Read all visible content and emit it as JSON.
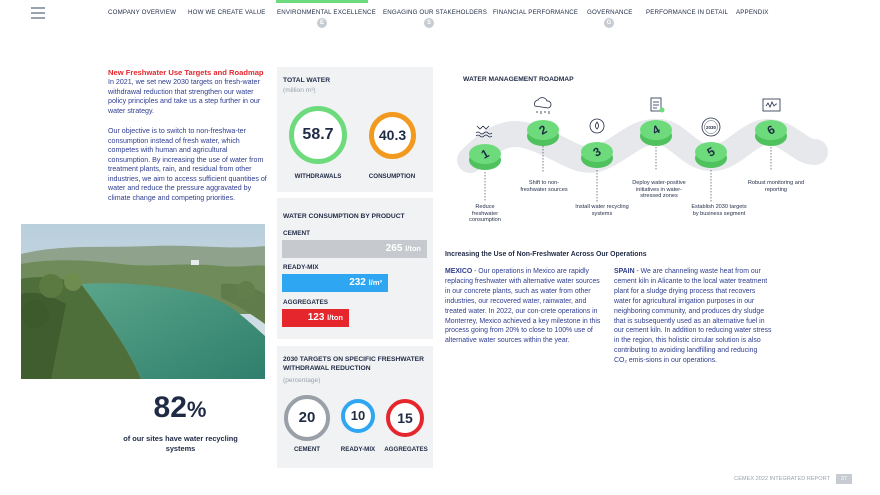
{
  "nav": {
    "items": [
      "COMPANY OVERVIEW",
      "HOW WE CREATE VALUE",
      "ENVIRONMENTAL EXCELLENCE",
      "ENGAGING OUR STAKEHOLDERS",
      "FINANCIAL PERFORMANCE",
      "GOVERNANCE",
      "PERFORMANCE IN DETAIL",
      "APPENDIX"
    ],
    "badges": [
      "E",
      "S",
      "G"
    ],
    "active_color": "#6ddb7b"
  },
  "intro": {
    "title": "New Freshwater Use Targets and Roadmap",
    "para1": "In 2021, we set new 2030 targets on fresh-water withdrawal reduction that strengthen our water policy principles and take us a step further in our water strategy.",
    "para2": "Our objective is to switch to non-freshwa-ter consumption instead of fresh water, which competes with human and agricultural consumption. By increasing the use of water from treatment plants, rain, and residual from other industries, we aim to access sufficient quantities of water and reduce the pressure aggravated by climate change and competing priorities."
  },
  "stat": {
    "value": "82",
    "unit": "%",
    "caption": "of our sites have water recycling systems"
  },
  "total_water": {
    "title": "TOTAL WATER",
    "subtitle": "(million m³)",
    "withdrawals_value": "58.7",
    "withdrawals_label": "WITHDRAWALS",
    "consumption_value": "40.3",
    "consumption_label": "CONSUMPTION",
    "colors": {
      "withdrawals": "#6ddb7b",
      "consumption": "#f29a1f"
    }
  },
  "by_product": {
    "title": "WATER CONSUMPTION BY PRODUCT",
    "items": [
      {
        "label": "CEMENT",
        "value": "265",
        "unit": "l/ton",
        "color": "#c6c9ce"
      },
      {
        "label": "READY-MIX",
        "value": "232",
        "unit": "l/m³",
        "color": "#2ea6f1"
      },
      {
        "label": "AGGREGATES",
        "value": "123",
        "unit": "l/ton",
        "color": "#e5262d"
      }
    ]
  },
  "targets": {
    "title": "2030 TARGETS ON SPECIFIC FRESHWATER WITHDRAWAL REDUCTION",
    "subtitle": "(percentage)",
    "items": [
      {
        "value": "20",
        "label": "CEMENT",
        "color": "#9aa0a8"
      },
      {
        "value": "10",
        "label": "READY-MIX",
        "color": "#2ea6f1"
      },
      {
        "value": "15",
        "label": "AGGREGATES",
        "color": "#e5262d"
      }
    ]
  },
  "roadmap": {
    "title": "WATER MANAGEMENT ROADMAP",
    "steps": [
      {
        "num": "1",
        "label": "Reduce freshwater consumption",
        "icon": "water-waves-icon"
      },
      {
        "num": "2",
        "label": "Shift to non-freshwater sources",
        "icon": "rain-cloud-icon"
      },
      {
        "num": "3",
        "label": "Install water recycling systems",
        "icon": "recycle-drop-icon"
      },
      {
        "num": "4",
        "label": "Deploy water-positive initiatives in water-stressed zones",
        "icon": "checklist-icon"
      },
      {
        "num": "5",
        "label": "Establish 2030 targets by business segment",
        "icon": "target-2030-icon",
        "icon_text": "2030"
      },
      {
        "num": "6",
        "label": "Robust monitoring and reporting",
        "icon": "monitor-icon"
      }
    ],
    "accent": "#6ddb7b"
  },
  "increasing": {
    "title": "Increasing the Use of Non-Freshwater Across Our Operations",
    "mexico_lead": "MEXICO",
    "mexico_text": " - Our operations in Mexico are rapidly replacing freshwater with alternative water sources in our concrete plants, such as water from other industries, our recovered water, rainwater, and treated water. In 2022, our con-crete operations in Monterrey, Mexico achieved a key milestone in this process going from 20% to close to 100% use of alternative water sources within the year.",
    "spain_lead": "SPAIN",
    "spain_text": " - We are channeling waste heat from our cement kiln in Alicante to the local water treatment plant for a sludge drying process that recovers water for agricultural irrigation purposes in our neighboring community, and produces dry sludge that is subsequently used as an alternative fuel in our cement kiln. In addition to reducing water stress in the region, this holistic circular solution is also contributing to avoiding landfilling and reducing CO₂ emis-sions in our operations."
  },
  "footer": {
    "report": "CEMEX 2022 INTEGRATED REPORT",
    "page": "37"
  }
}
